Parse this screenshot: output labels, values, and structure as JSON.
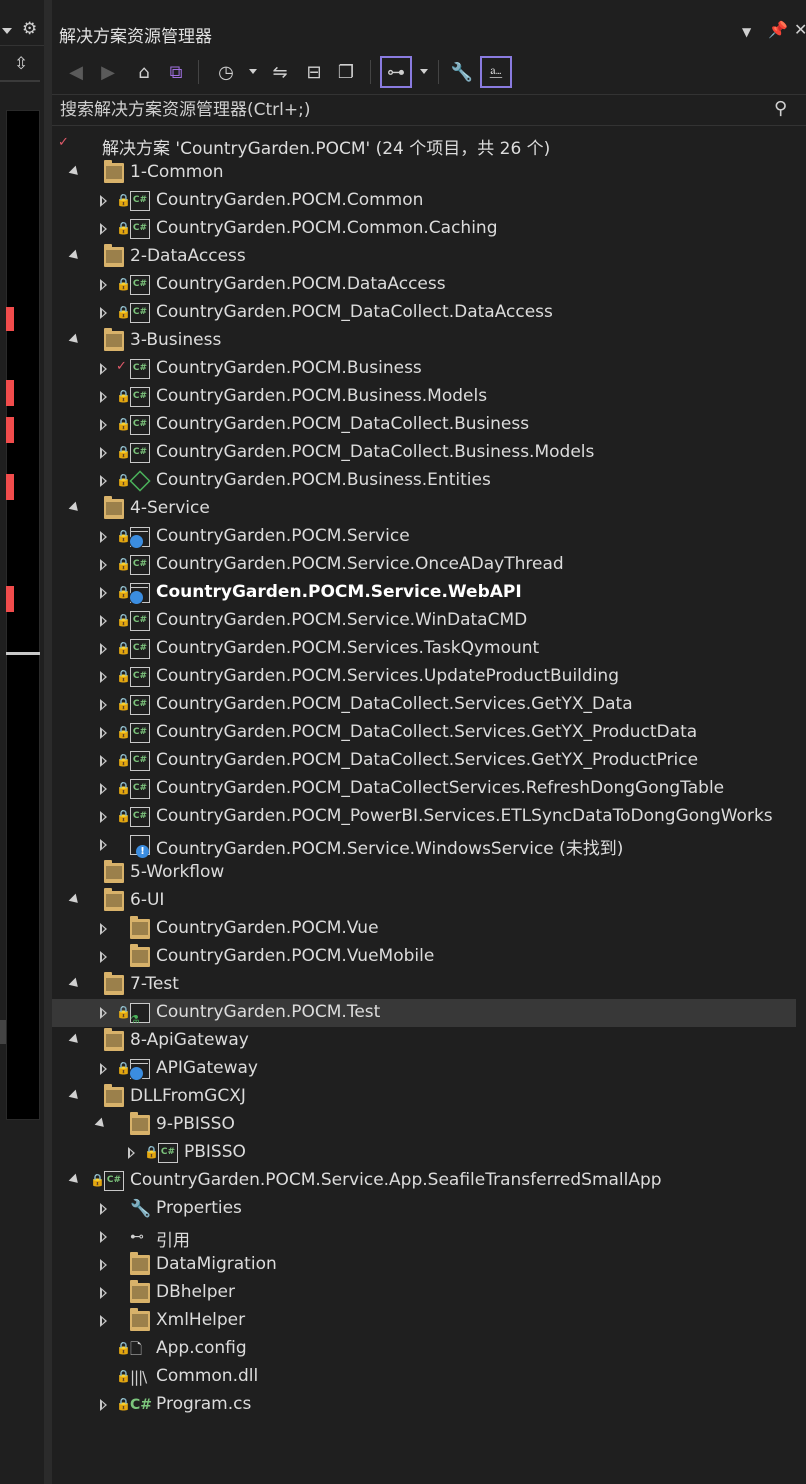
{
  "panel": {
    "title": "解决方案资源管理器",
    "search_placeholder": "搜索解决方案资源管理器(Ctrl+;)"
  },
  "toolbar": {
    "buttons": [
      "back-icon",
      "forward-icon",
      "home-icon",
      "vs-switch-views-icon",
      "pending-changes-icon",
      "sync-icon",
      "collapse-all-icon",
      "show-all-files-icon",
      "preview-selected-icon",
      "properties-icon",
      "filter-icon"
    ]
  },
  "tree": [
    {
      "label": "解决方案 'CountryGarden.POCM' (24 个项目，共 26 个)",
      "icon": "solution",
      "depth": 0,
      "arrow": "none",
      "badge": "check"
    },
    {
      "label": "1-Common",
      "icon": "folder",
      "depth": 1,
      "arrow": "expanded"
    },
    {
      "label": "CountryGarden.POCM.Common",
      "icon": "csproj",
      "depth": 2,
      "arrow": "collapsed",
      "badge": "lock"
    },
    {
      "label": "CountryGarden.POCM.Common.Caching",
      "icon": "csproj",
      "depth": 2,
      "arrow": "collapsed",
      "badge": "lock"
    },
    {
      "label": "2-DataAccess",
      "icon": "folder",
      "depth": 1,
      "arrow": "expanded"
    },
    {
      "label": "CountryGarden.POCM.DataAccess",
      "icon": "csproj",
      "depth": 2,
      "arrow": "collapsed",
      "badge": "lock"
    },
    {
      "label": "CountryGarden.POCM_DataCollect.DataAccess",
      "icon": "csproj",
      "depth": 2,
      "arrow": "collapsed",
      "badge": "lock"
    },
    {
      "label": "3-Business",
      "icon": "folder",
      "depth": 1,
      "arrow": "expanded"
    },
    {
      "label": "CountryGarden.POCM.Business",
      "icon": "csproj",
      "depth": 2,
      "arrow": "collapsed",
      "badge": "check"
    },
    {
      "label": "CountryGarden.POCM.Business.Models",
      "icon": "csproj",
      "depth": 2,
      "arrow": "collapsed",
      "badge": "lock"
    },
    {
      "label": "CountryGarden.POCM_DataCollect.Business",
      "icon": "csproj",
      "depth": 2,
      "arrow": "collapsed",
      "badge": "lock"
    },
    {
      "label": "CountryGarden.POCM_DataCollect.Business.Models",
      "icon": "csproj",
      "depth": 2,
      "arrow": "collapsed",
      "badge": "lock"
    },
    {
      "label": "CountryGarden.POCM.Business.Entities",
      "icon": "diamond",
      "depth": 2,
      "arrow": "collapsed",
      "badge": "lock"
    },
    {
      "label": "4-Service",
      "icon": "folder",
      "depth": 1,
      "arrow": "expanded"
    },
    {
      "label": "CountryGarden.POCM.Service",
      "icon": "web",
      "depth": 2,
      "arrow": "collapsed",
      "badge": "lock"
    },
    {
      "label": "CountryGarden.POCM.Service.OnceADayThread",
      "icon": "csproj",
      "depth": 2,
      "arrow": "collapsed",
      "badge": "lock"
    },
    {
      "label": "CountryGarden.POCM.Service.WebAPI",
      "icon": "web",
      "depth": 2,
      "arrow": "collapsed",
      "badge": "lock",
      "bold": true
    },
    {
      "label": "CountryGarden.POCM.Service.WinDataCMD",
      "icon": "csproj",
      "depth": 2,
      "arrow": "collapsed",
      "badge": "lock"
    },
    {
      "label": "CountryGarden.POCM.Services.TaskQymount",
      "icon": "csproj",
      "depth": 2,
      "arrow": "collapsed",
      "badge": "lock"
    },
    {
      "label": "CountryGarden.POCM.Services.UpdateProductBuilding",
      "icon": "csproj",
      "depth": 2,
      "arrow": "collapsed",
      "badge": "lock"
    },
    {
      "label": "CountryGarden.POCM_DataCollect.Services.GetYX_Data",
      "icon": "csproj",
      "depth": 2,
      "arrow": "collapsed",
      "badge": "lock"
    },
    {
      "label": "CountryGarden.POCM_DataCollect.Services.GetYX_ProductData",
      "icon": "csproj",
      "depth": 2,
      "arrow": "collapsed",
      "badge": "lock"
    },
    {
      "label": "CountryGarden.POCM_DataCollect.Services.GetYX_ProductPrice",
      "icon": "csproj",
      "depth": 2,
      "arrow": "collapsed",
      "badge": "lock"
    },
    {
      "label": "CountryGarden.POCM_DataCollectServices.RefreshDongGongTable",
      "icon": "csproj",
      "depth": 2,
      "arrow": "collapsed",
      "badge": "lock"
    },
    {
      "label": "CountryGarden.POCM_PowerBI.Services.ETLSyncDataToDongGongWorks",
      "icon": "csproj",
      "depth": 2,
      "arrow": "collapsed",
      "badge": "lock"
    },
    {
      "label": "CountryGarden.POCM.Service.WindowsService (未找到)",
      "icon": "warnproj",
      "depth": 2,
      "arrow": "collapsed",
      "badge": "none"
    },
    {
      "label": "5-Workflow",
      "icon": "folder",
      "depth": 1,
      "arrow": "none"
    },
    {
      "label": "6-UI",
      "icon": "folder",
      "depth": 1,
      "arrow": "expanded"
    },
    {
      "label": "CountryGarden.POCM.Vue",
      "icon": "folder",
      "depth": 2,
      "arrow": "collapsed",
      "badge": "none"
    },
    {
      "label": "CountryGarden.POCM.VueMobile",
      "icon": "folder",
      "depth": 2,
      "arrow": "collapsed",
      "badge": "none"
    },
    {
      "label": "7-Test",
      "icon": "folder",
      "depth": 1,
      "arrow": "expanded"
    },
    {
      "label": "CountryGarden.POCM.Test",
      "icon": "testproj",
      "depth": 2,
      "arrow": "collapsed",
      "badge": "lock",
      "selected": true
    },
    {
      "label": "8-ApiGateway",
      "icon": "folder",
      "depth": 1,
      "arrow": "expanded"
    },
    {
      "label": "APIGateway",
      "icon": "web",
      "depth": 2,
      "arrow": "collapsed",
      "badge": "lock"
    },
    {
      "label": "DLLFromGCXJ",
      "icon": "folder",
      "depth": 1,
      "arrow": "expanded"
    },
    {
      "label": "9-PBISSO",
      "icon": "folder",
      "depth": 2,
      "arrow": "expanded",
      "badge": "none"
    },
    {
      "label": "PBISSO",
      "icon": "csproj",
      "depth": 3,
      "arrow": "collapsed",
      "badge": "lock"
    },
    {
      "label": "CountryGarden.POCM.Service.App.SeafileTransferredSmallApp",
      "icon": "csproj",
      "depth": 1,
      "arrow": "expanded",
      "badge": "lock"
    },
    {
      "label": "Properties",
      "icon": "wrench",
      "depth": 2,
      "arrow": "collapsed",
      "badge": "none"
    },
    {
      "label": "引用",
      "icon": "refs",
      "depth": 2,
      "arrow": "collapsed",
      "badge": "none"
    },
    {
      "label": "DataMigration",
      "icon": "folder",
      "depth": 2,
      "arrow": "collapsed",
      "badge": "none"
    },
    {
      "label": "DBhelper",
      "icon": "folder",
      "depth": 2,
      "arrow": "collapsed",
      "badge": "none"
    },
    {
      "label": "XmlHelper",
      "icon": "folder",
      "depth": 2,
      "arrow": "collapsed",
      "badge": "none"
    },
    {
      "label": "App.config",
      "icon": "config",
      "depth": 2,
      "arrow": "none",
      "badge": "lock"
    },
    {
      "label": "Common.dll",
      "icon": "dll",
      "depth": 2,
      "arrow": "none",
      "badge": "lock"
    },
    {
      "label": "Program.cs",
      "icon": "cs",
      "depth": 2,
      "arrow": "collapsed",
      "badge": "lock"
    }
  ]
}
